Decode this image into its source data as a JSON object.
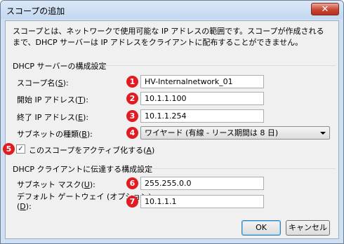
{
  "window": {
    "title": "スコープの追加",
    "close_label": "✕"
  },
  "description": "スコープとは、ネットワークで使用可能な IP アドレスの範囲です。スコープが作成されるまで、DHCP サーバーは IP アドレスをクライアントに配布することができません。",
  "server_group": {
    "label": "DHCP サーバーの構成設定",
    "scope_name": {
      "label_pre": "スコープ名(",
      "accel": "S",
      "label_post": "):",
      "value": "HV-Internalnetwork_01",
      "badge": "1"
    },
    "start_ip": {
      "label_pre": "開始 IP アドレス(",
      "accel": "T",
      "label_post": "):",
      "value": "10.1.1.100",
      "badge": "2"
    },
    "end_ip": {
      "label_pre": "終了 IP アドレス(",
      "accel": "E",
      "label_post": "):",
      "value": "10.1.1.254",
      "badge": "3"
    },
    "subnet_type": {
      "label_pre": "サブネットの種類(",
      "accel": "B",
      "label_post": "):",
      "value": "ワイヤード (有線 - リース期間は 8 日)",
      "badge": "4"
    },
    "activate": {
      "label_pre": "このスコープをアクティブ化する(",
      "accel": "A",
      "label_post": ")",
      "checked": true,
      "check_glyph": "✓",
      "badge": "5"
    }
  },
  "client_group": {
    "label": "DHCP クライアントに伝達する構成設定",
    "subnet_mask": {
      "label_pre": "サブネット マスク(",
      "accel": "U",
      "label_post": "):",
      "value": "255.255.0.0",
      "badge": "6"
    },
    "gateway": {
      "label_line1": "デフォルト ゲートウェイ (オプション)",
      "label_pre": "(",
      "accel": "D",
      "label_post": "):",
      "value": "10.1.1.1",
      "badge": "7"
    }
  },
  "buttons": {
    "ok": "OK",
    "cancel": "キャンセル"
  },
  "colors": {
    "badge": "#e01b22",
    "title_bar": "#c4d8f0",
    "close_button": "#c74632"
  }
}
